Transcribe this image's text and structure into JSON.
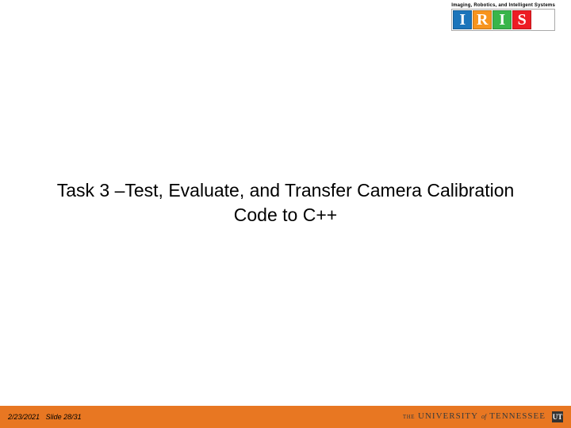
{
  "logo": {
    "caption": "Imaging, Robotics, and Intelligent Systems",
    "letters": [
      "I",
      "R",
      "I",
      "S"
    ]
  },
  "title": "Task 3 –Test, Evaluate, and Transfer Camera Calibration Code to C++",
  "footer": {
    "date": "2/23/2021",
    "slide": "Slide 28/31",
    "university": {
      "the": "THE",
      "university": "UNIVERSITY",
      "of": "of",
      "tn": "TENNESSEE",
      "mark": "UT"
    }
  }
}
